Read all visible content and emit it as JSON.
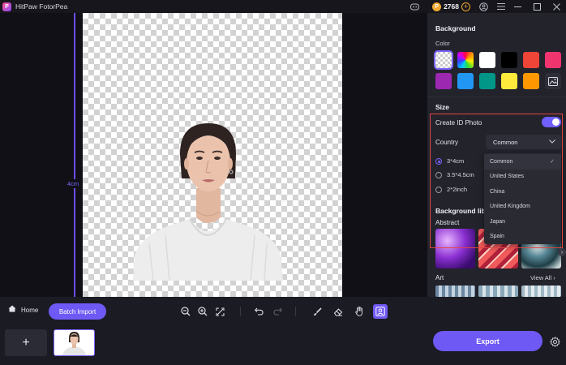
{
  "app": {
    "title": "HitPaw FotorPea",
    "logo_letter": "P",
    "credits": "2768"
  },
  "canvas": {
    "ruler_label": "4cm"
  },
  "panel": {
    "background_title": "Background",
    "color_label": "Color",
    "colors": [
      "transparent",
      "rainbow",
      "#ffffff",
      "#000000",
      "#ef4438",
      "#f0346e",
      "#9c27b0",
      "#2196f3",
      "#009688",
      "#ffeb3b",
      "#ff9800",
      "custom"
    ],
    "size_title": "Size",
    "create_id_photo": "Create ID Photo",
    "create_id_photo_on": true,
    "country_label": "Country",
    "country_selected": "Common",
    "sizes": [
      {
        "label": "3*4cm",
        "selected": true
      },
      {
        "label": "3.5*4.5cm",
        "selected": false
      },
      {
        "label": "2*2inch",
        "selected": false
      }
    ],
    "dropdown_options": [
      "Common",
      "United States",
      "China",
      "United Kingdom",
      "Japan",
      "Spain"
    ],
    "bg_library_title": "Background lib",
    "abstract_label": "Abstract",
    "art_label": "Art",
    "view_all": "View All"
  },
  "toolbar": {
    "home": "Home",
    "batch_import": "Batch Import"
  },
  "strip": {
    "add": "+",
    "export": "Export"
  }
}
